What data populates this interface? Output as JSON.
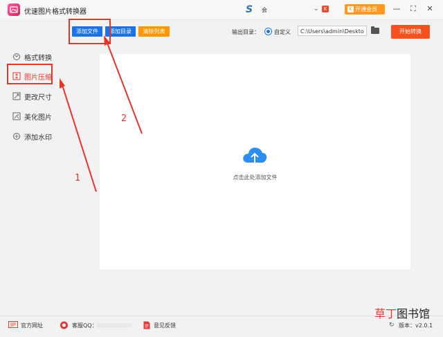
{
  "app": {
    "title": "优速图片格式转换器"
  },
  "account": {
    "name": "会",
    "vip_label": "开通会员",
    "vip_icon_text": "K"
  },
  "sidebar": {
    "items": [
      {
        "label": "格式转换",
        "icon": "refresh-icon",
        "active": false
      },
      {
        "label": "图片压缩",
        "icon": "compress-icon",
        "active": true
      },
      {
        "label": "更改尺寸",
        "icon": "resize-icon",
        "active": false
      },
      {
        "label": "美化图片",
        "icon": "beautify-icon",
        "active": false
      },
      {
        "label": "添加水印",
        "icon": "watermark-icon",
        "active": false
      }
    ]
  },
  "toolbar": {
    "add_file": "添加文件",
    "add_folder": "添加目录",
    "clear_list": "清除列表",
    "output_label": "输出目录：",
    "custom_option": "自定义",
    "output_path": "C:\\Users\\admin\\Deskto",
    "start_button": "开始转换"
  },
  "drop_area": {
    "hint": "点击此处添加文件"
  },
  "statusbar": {
    "website": "官方网址",
    "qq": "客服QQ：",
    "feedback": "意见反馈",
    "version": "版本：v2.0.1"
  },
  "watermark": {
    "part1": "草丁",
    "part2": "图书馆"
  },
  "annotations": {
    "step1": "1",
    "step2": "2"
  },
  "colors": {
    "accent": "#e53935",
    "blue_button": "#1a73e8",
    "orange_button": "#ff9800",
    "start_button": "#f4511e",
    "annotation": "#ea3323"
  }
}
